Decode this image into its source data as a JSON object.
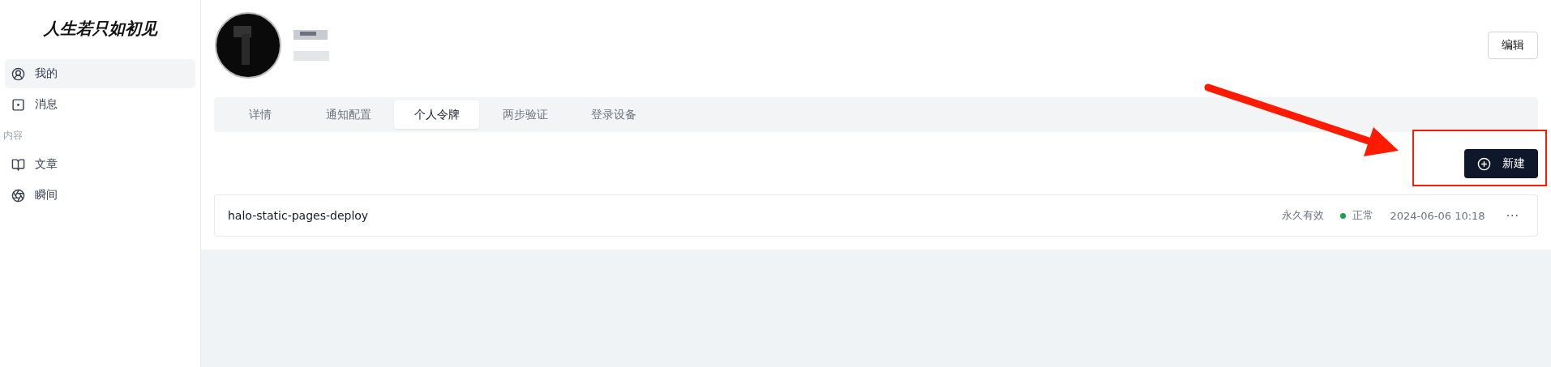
{
  "sidebar": {
    "logo": "人生若只如初见",
    "items": [
      {
        "kind": "nav",
        "label": "我的",
        "selected": true
      },
      {
        "kind": "nav",
        "label": "消息",
        "selected": false
      },
      {
        "kind": "heading",
        "label": "内容"
      },
      {
        "kind": "nav",
        "label": "文章",
        "selected": false
      },
      {
        "kind": "nav",
        "label": "瞬间",
        "selected": false
      }
    ]
  },
  "profile": {
    "edit_button": "编辑"
  },
  "tabs": [
    {
      "label": "详情",
      "selected": false
    },
    {
      "label": "通知配置",
      "selected": false
    },
    {
      "label": "个人令牌",
      "selected": true
    },
    {
      "label": "两步验证",
      "selected": false
    },
    {
      "label": "登录设备",
      "selected": false
    }
  ],
  "new_button": "新建",
  "tokens": [
    {
      "name": "halo-static-pages-deploy",
      "expiry": "永久有效",
      "status": "正常",
      "color": "#16a34a",
      "created": "2024-06-06 10:18",
      "menu": "···"
    }
  ]
}
